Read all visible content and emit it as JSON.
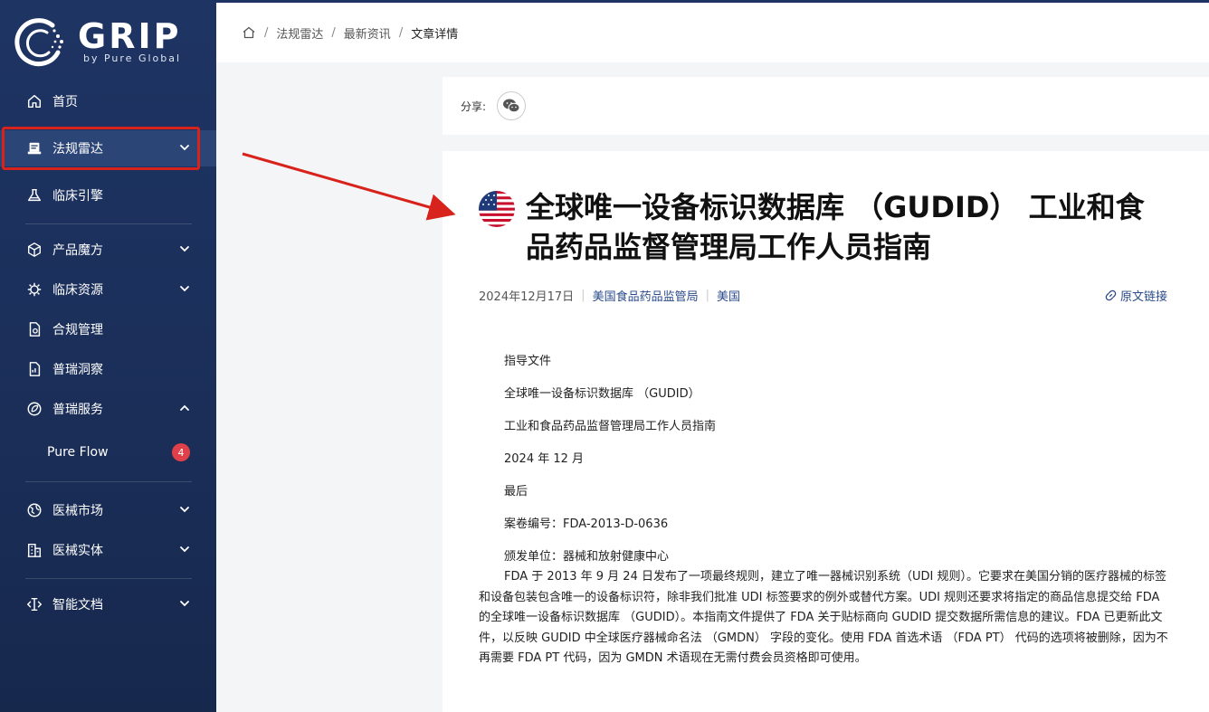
{
  "logo": {
    "name": "GRIP",
    "sub": "by Pure Global"
  },
  "sidebar": {
    "items": [
      {
        "label": "首页"
      },
      {
        "label": "法规雷达"
      },
      {
        "label": "临床引擎"
      },
      {
        "label": "产品魔方"
      },
      {
        "label": "临床资源"
      },
      {
        "label": "合规管理"
      },
      {
        "label": "普瑞洞察"
      },
      {
        "label": "普瑞服务"
      },
      {
        "label": "Pure Flow",
        "badge": "4"
      },
      {
        "label": "医械市场"
      },
      {
        "label": "医械实体"
      },
      {
        "label": "智能文档"
      }
    ]
  },
  "breadcrumb": {
    "items": [
      "法规雷达",
      "最新资讯"
    ],
    "current": "文章详情"
  },
  "share": {
    "label": "分享:"
  },
  "article": {
    "title": "全球唯一设备标识数据库 （GUDID） 工业和食品药品监督管理局工作人员指南",
    "date": "2024年12月17日",
    "agency": "美国食品药品监管局",
    "country": "美国",
    "source_link": "原文链接",
    "lines": [
      "指导文件",
      "全球唯一设备标识数据库 （GUDID）",
      "工业和食品药品监督管理局工作人员指南",
      "2024 年 12 月",
      "最后",
      "案卷编号：FDA-2013-D-0636",
      "颁发单位：器械和放射健康中心"
    ],
    "paragraph": "FDA 于 2013 年 9 月 24 日发布了一项最终规则，建立了唯一器械识别系统（UDI 规则）。它要求在美国分销的医疗器械的标签和设备包装包含唯一的设备标识符，除非我们批准 UDI 标签要求的例外或替代方案。UDI 规则还要求将指定的商品信息提交给 FDA 的全球唯一设备标识数据库 （GUDID）。本指南文件提供了 FDA 关于贴标商向 GUDID 提交数据所需信息的建议。FDA 已更新此文件，以反映 GUDID 中全球医疗器械命名法 （GMDN） 字段的变化。使用 FDA 首选术语 （FDA PT） 代码的选项将被删除，因为不再需要 FDA PT 代码，因为 GMDN 术语现在无需付费会员资格即可使用。"
  },
  "colors": {
    "sidebar": "#1e3463",
    "highlight": "#d8231d",
    "arrow": "#d8231d",
    "badge": "#e0404a",
    "link": "#2a4a8a"
  }
}
